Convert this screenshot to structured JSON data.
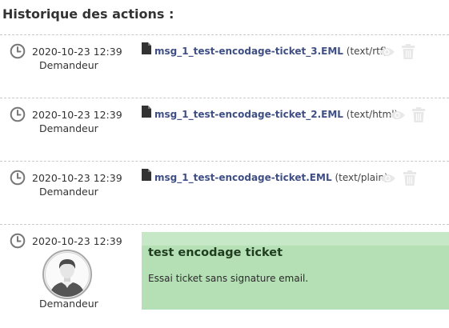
{
  "history": {
    "title": "Historique des actions :",
    "entries": [
      {
        "date": "2020-10-23 12:39",
        "author": "Demandeur",
        "document": {
          "name": "msg_1_test-encodage-ticket_3.EML",
          "mime": "(text/rtf)"
        }
      },
      {
        "date": "2020-10-23 12:39",
        "author": "Demandeur",
        "document": {
          "name": "msg_1_test-encodage-ticket_2.EML",
          "mime": "(text/html)"
        }
      },
      {
        "date": "2020-10-23 12:39",
        "author": "Demandeur",
        "document": {
          "name": "msg_1_test-encodage-ticket.EML",
          "mime": "(text/plain)"
        }
      },
      {
        "date": "2020-10-23 12:39",
        "author": "Demandeur",
        "message": {
          "title": "test encodage ticket",
          "body": "Essai ticket sans signature email."
        }
      }
    ]
  },
  "icons": {
    "clock": "clock-icon",
    "file": "file-icon",
    "eye": "eye-icon",
    "trash": "trash-icon",
    "avatar": "user-avatar"
  },
  "colors": {
    "link": "#3f4f85",
    "message_bg": "#b5e0b5",
    "message_header": "#c6e8c6",
    "action_icon_muted": "#e8e8e8"
  }
}
